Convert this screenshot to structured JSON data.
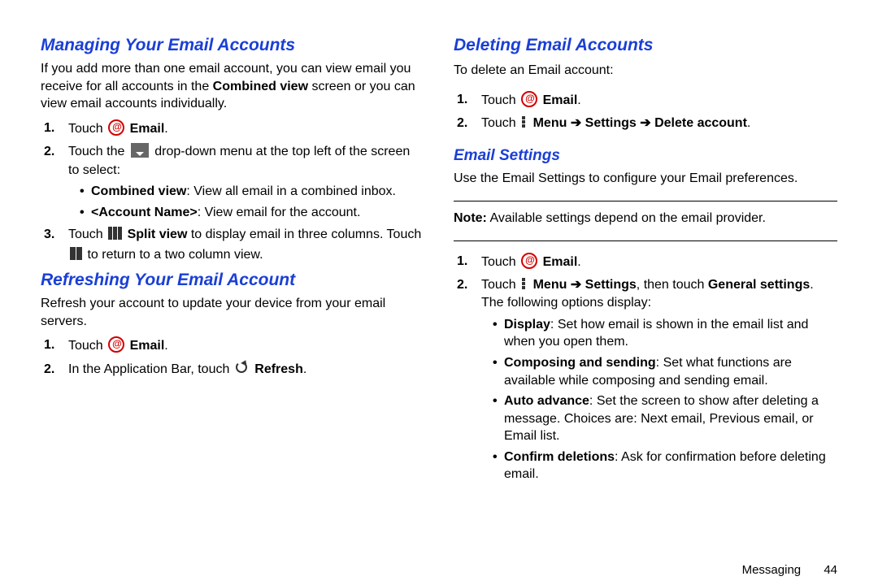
{
  "left": {
    "h_managing": "Managing Your Email Accounts",
    "intro_full": "If you add more than one email account, you can view email you receive for all accounts in the Combined view screen or you can view email accounts individually.",
    "intro0": "If you add more than one email account, you can view email you receive for all accounts in the ",
    "intro_b": "Combined view",
    "intro1": " screen or you can view email accounts individually.",
    "touch": "Touch ",
    "email": "Email",
    "s1b_a": "Touch the ",
    "s1b_b": " drop-down menu at the top left of the screen to select:",
    "combined_b": "Combined view",
    "combined_t": ": View all email in a combined inbox.",
    "acct_b": "<Account Name>",
    "acct_t": ": View email for the account.",
    "s1c_a": "Touch ",
    "splitview": "Split view",
    "s1c_b": " to display email in three columns. Touch ",
    "s1c_c": " to return to a two column view.",
    "h_refresh": "Refreshing Your Email Account",
    "refresh_p": "Refresh your account to update your device from your email servers.",
    "s2b": "In the Application Bar, touch ",
    "refresh": "Refresh"
  },
  "right": {
    "h_delete": "Deleting Email Accounts",
    "del_intro": "To delete an Email account:",
    "s1b_a": "Touch ",
    "menu": "Menu",
    "settings": "Settings",
    "del_acc": "Delete account",
    "h_settings": "Email Settings",
    "use_p": "Use the Email Settings to configure your Email preferences.",
    "note_b": "Note:",
    "note_t": " Available settings depend on the email provider.",
    "s2b_a": "Touch ",
    "s2b_b": ", then touch ",
    "gen_b": "General settings",
    "gen_t": ". The following options display:",
    "display_b": "Display",
    "display_t": ": Set how email is shown in the email list and when you open them.",
    "compose_b": "Composing and sending",
    "compose_t": ": Set what functions are available while composing and sending email.",
    "auto_b": "Auto advance",
    "auto_t": ": Set the screen to show after deleting a message. Choices are: Next email, Previous email, or Email list.",
    "confirm_b": "Confirm deletions",
    "confirm_t": ": Ask for confirmation before deleting email."
  },
  "footer": {
    "section": "Messaging",
    "page": "44"
  }
}
